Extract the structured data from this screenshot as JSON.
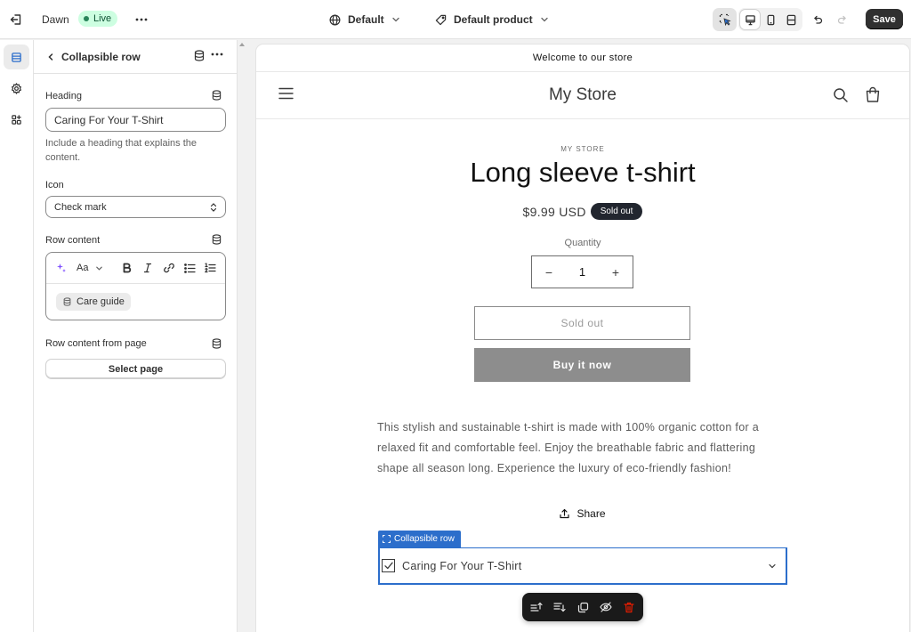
{
  "topbar": {
    "theme_name": "Dawn",
    "status": "Live",
    "template": "Default",
    "product": "Default product",
    "save_label": "Save"
  },
  "panel": {
    "title": "Collapsible row",
    "heading_label": "Heading",
    "heading_value": "Caring For Your T-Shirt",
    "heading_help": "Include a heading that explains the content.",
    "icon_label": "Icon",
    "icon_value": "Check mark",
    "row_content_label": "Row content",
    "rte_font_label": "Aa",
    "metafield_chip": "Care guide",
    "row_page_label": "Row content from page",
    "select_page_label": "Select page"
  },
  "preview": {
    "announcement": "Welcome to our store",
    "store_name": "My Store",
    "vendor": "MY STORE",
    "product_title": "Long sleeve t-shirt",
    "price": "$9.99 USD",
    "badge": "Sold out",
    "quantity_label": "Quantity",
    "quantity_value": "1",
    "qty_minus": "−",
    "qty_plus": "+",
    "sold_out_button": "Sold out",
    "buy_button": "Buy it now",
    "description": "This stylish and sustainable t-shirt is made with 100% organic cotton for a relaxed fit and comfortable feel. Enjoy the breathable fabric and flattering shape all season long. Experience the luxury of eco-friendly fashion!",
    "share_label": "Share",
    "section_tag": "Collapsible row",
    "collapsible_title": "Caring For Your T-Shirt"
  },
  "colors": {
    "selection_blue": "#2c6ecb",
    "live_badge_bg": "#cdfee1",
    "save_bg": "#303030",
    "delete_red": "#e51c00"
  },
  "icons": [
    "exit-icon",
    "ellipsis-icon",
    "globe-icon",
    "tag-icon",
    "chevron-down-icon",
    "inspector-icon",
    "desktop-icon",
    "mobile-icon",
    "fullscreen-icon",
    "undo-icon",
    "redo-icon",
    "sections-icon",
    "settings-gear-icon",
    "apps-icon",
    "chevron-left-icon",
    "database-icon",
    "sparkle-icon",
    "bold-icon",
    "italic-icon",
    "link-icon",
    "bullet-list-icon",
    "numbered-list-icon",
    "menu-icon",
    "search-icon",
    "cart-icon",
    "share-icon",
    "check-icon",
    "move-up-icon",
    "move-down-icon",
    "duplicate-icon",
    "hide-icon",
    "delete-icon"
  ]
}
